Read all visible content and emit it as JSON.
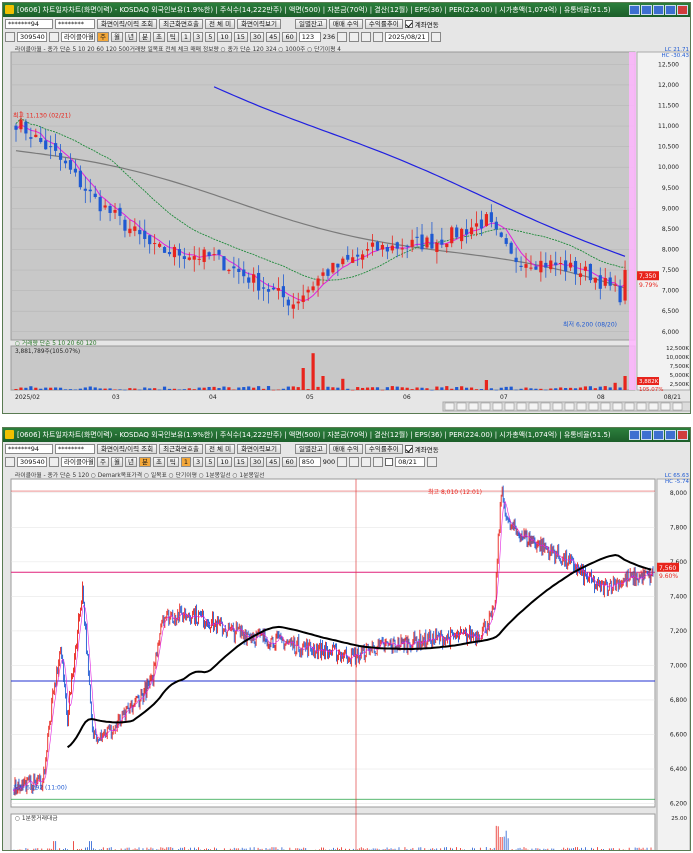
{
  "windows": [
    {
      "title": "[0606] 차트일자차트(화면이력) - KOSDAQ 외국인보유(1.9%한) | 주식수(14,222만주) | 액면(500) | 자본금(70억) | 결산(12월) | EPS(36) | PER(224.00) | 시가총액(1,074억) | 유통비율(51.5)",
      "toolbar1": {
        "account": "*******94",
        "password": "********",
        "buttons": [
          "화면이력/이력 조회",
          "최근화면호출",
          "전 체 미",
          "화면이력보기"
        ],
        "order_buttons": [
          "일별잔고",
          "매매 수익",
          "수익률추이"
        ],
        "link_label": "계좌연동"
      },
      "toolbar2": {
        "code": "309540",
        "name": "라이클아월",
        "periods": [
          "주",
          "월",
          "년",
          "분",
          "초",
          "틱"
        ],
        "intervals": [
          "1",
          "3",
          "5",
          "10",
          "15",
          "30",
          "45",
          "60"
        ],
        "count_value": "123",
        "count_total": "236",
        "date": "2025/08/21"
      },
      "legend": "라이클아월 - 종가 단순 5 10 20 60 120 500거래량 일목표 전체 체크 매매 정보량 ○ 종가 단순 120 324 ○ 1000주 ○ 단기이평 4",
      "y_labels": [
        "12,500",
        "12,000",
        "11,500",
        "11,000",
        "10,500",
        "10,000",
        "9,500",
        "9,000",
        "8,500",
        "8,000",
        "7,500",
        "7,000",
        "6,500",
        "6,000"
      ],
      "top_right": {
        "lc": "LC 21.71",
        "hc": "HC -30.43"
      },
      "price_tag": "7,350",
      "price_pct": "9.79%",
      "high_marker": "최고 11,130 (02/21)",
      "low_marker": "최저 6,200 (08/20)",
      "volume_legend": "○ 거래량 단순 5 10 20 60 120",
      "volume_value": "3,881,789주(105.07%)",
      "vol_y_labels": [
        "12,500K",
        "10,000K",
        "7,500K",
        "5,000K",
        "2,500K"
      ],
      "vol_tag": "3,882K",
      "vol_pct": "105.07%",
      "x_labels": [
        "2025/02",
        "03",
        "04",
        "05",
        "06",
        "07",
        "08"
      ],
      "x_end": "08/21"
    },
    {
      "title": "[0606] 차트일자차트(화면이력) - KOSDAQ 외국인보유(1.9%한) | 주식수(14,222만주) | 액면(500) | 자본금(70억) | 결산(12월) | EPS(36) | PER(224.00) | 시가총액(1,074억) | 유통비율(51.5)",
      "toolbar1": {
        "account": "*******94",
        "password": "********",
        "buttons": [
          "화면이력/이력 조회",
          "최근화면호출",
          "전 체 미",
          "화면이력보기"
        ],
        "order_buttons": [
          "일별잔고",
          "매매 수익",
          "수익률추이"
        ],
        "link_label": "계좌연동"
      },
      "toolbar2": {
        "code": "309540",
        "name": "라이클아월",
        "periods": [
          "주",
          "월",
          "년",
          "분",
          "초",
          "틱"
        ],
        "intervals": [
          "1",
          "3",
          "5",
          "10",
          "15",
          "30",
          "45",
          "60"
        ],
        "count_value": "850",
        "count_total": "900",
        "date": "08/21"
      },
      "legend": "라이클아월 - 종가 단순 5 120 ○ Demark목표가격 ○ 일목표 ○ 단기이평 ○ 1분봉일선 ○ 1분봉일선",
      "y_labels": [
        "8,000",
        "7,800",
        "7,600",
        "7,400",
        "7,200",
        "7,000",
        "6,800",
        "6,600",
        "6,400",
        "6,200"
      ],
      "top_right": {
        "lc": "LC 65.63",
        "hc": "HC -5.74"
      },
      "price_tag": "7,560",
      "price_pct": "9.60%",
      "high_marker": "최고 8,010 (12:01)",
      "low_marker": "최저 6,292 (11:00)",
      "volume_legend": "○ 1분봉거래대금",
      "vol_y_labels": [
        "25.00"
      ]
    }
  ],
  "colors": {
    "chart_bg": "#c8c8c8",
    "up": "#e8241c",
    "down": "#1f5ad2",
    "ma_magenta": "#e020e0",
    "ma_green": "#1e8a3a",
    "ma_gray": "#7a7a7a",
    "ma_blue": "#2020e0",
    "highlight": "#ffb6ff"
  }
}
